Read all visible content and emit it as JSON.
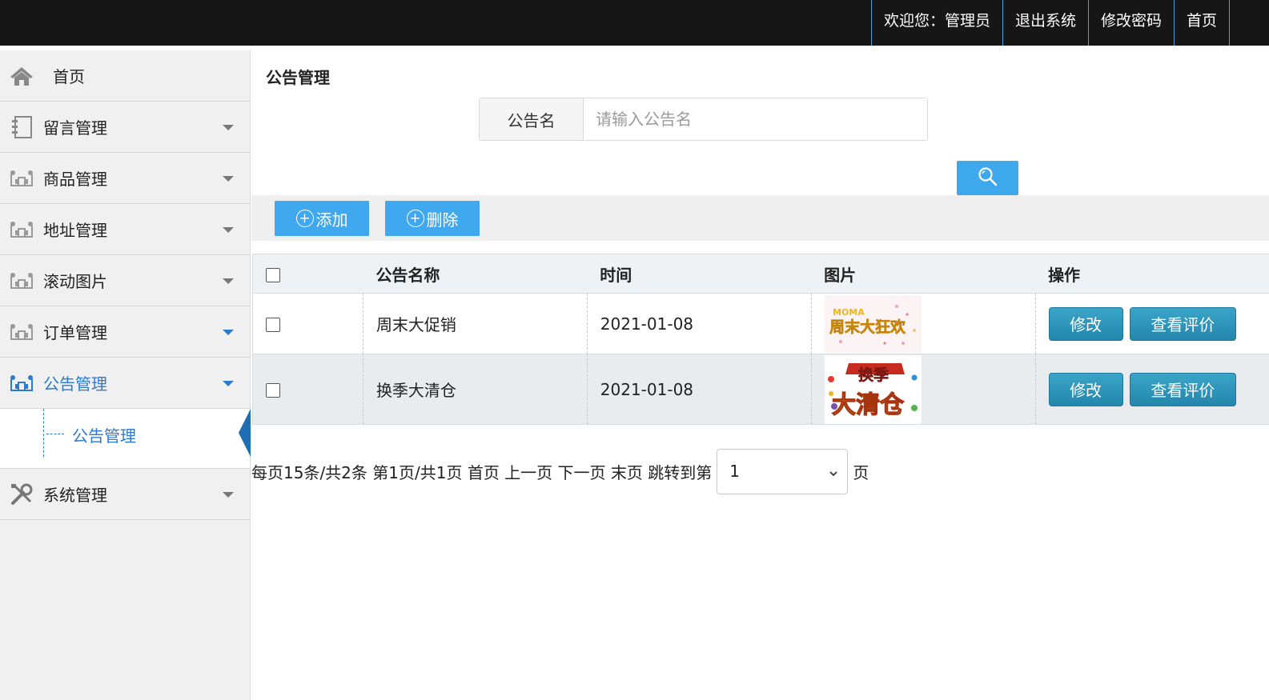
{
  "topbar": {
    "welcome": "欢迎您：管理员",
    "logout": "退出系统",
    "change_password": "修改密码",
    "home": "首页"
  },
  "sidebar": {
    "items": [
      {
        "label": "首页",
        "icon": "home-icon"
      },
      {
        "label": "留言管理",
        "icon": "notebook-icon"
      },
      {
        "label": "商品管理",
        "icon": "module-icon"
      },
      {
        "label": "地址管理",
        "icon": "module-icon"
      },
      {
        "label": "滚动图片",
        "icon": "module-icon"
      },
      {
        "label": "订单管理",
        "icon": "module-icon"
      },
      {
        "label": "公告管理",
        "icon": "module-icon"
      },
      {
        "label": "系统管理",
        "icon": "tools-icon"
      }
    ],
    "submenu": {
      "label": "公告管理"
    }
  },
  "main": {
    "title": "公告管理",
    "search": {
      "label": "公告名",
      "placeholder": "请输入公告名",
      "button_icon": "search-icon"
    },
    "toolbar": {
      "add": "添加",
      "delete": "删除"
    },
    "table": {
      "headers": [
        "公告名称",
        "时间",
        "图片",
        "操作"
      ],
      "rows": [
        {
          "name": "周末大促销",
          "date": "2021-01-08",
          "image_text": "周末大狂欢",
          "image_badge": "MOMA",
          "edit": "修改",
          "view": "查看评价"
        },
        {
          "name": "换季大清仓",
          "date": "2021-01-08",
          "image_text_top": "换季",
          "image_text_bottom": "大清仓",
          "edit": "修改",
          "view": "查看评价"
        }
      ]
    },
    "pager": {
      "summary": "每页15条/共2条 第1页/共1页 首页 上一页 下一页 末页 跳转到第",
      "page_value": "1",
      "suffix": "页"
    }
  },
  "colors": {
    "topbar_bg": "#161616",
    "accent_blue": "#3ea8ec",
    "menu_active": "#2b7ad0",
    "op_button": "#2386ad"
  }
}
